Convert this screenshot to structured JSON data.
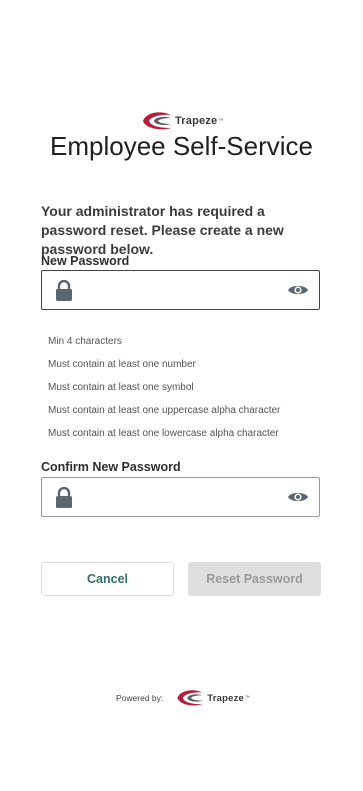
{
  "brand": {
    "name": "Trapeze",
    "tm": "™",
    "color_primary": "#b71c3a",
    "color_secondary": "#5a5a5a"
  },
  "page": {
    "title": "Employee Self-Service",
    "instructions": "Your administrator has required a password reset. Please create a new password below."
  },
  "new_password": {
    "label": "New Password",
    "value": "",
    "placeholder": "",
    "lock_icon": "lock-icon",
    "toggle_icon": "eye-icon"
  },
  "rules": [
    "Min 4 characters",
    "Must contain at least one number",
    "Must contain at least one symbol",
    "Must contain at least one uppercase alpha character",
    "Must contain at least one lowercase alpha character"
  ],
  "confirm_password": {
    "label": "Confirm New Password",
    "value": "",
    "placeholder": "",
    "lock_icon": "lock-icon",
    "toggle_icon": "eye-icon"
  },
  "buttons": {
    "cancel_label": "Cancel",
    "reset_label": "Reset Password",
    "accent_color": "#2e6f6d"
  },
  "footer": {
    "powered_by": "Powered by:"
  }
}
